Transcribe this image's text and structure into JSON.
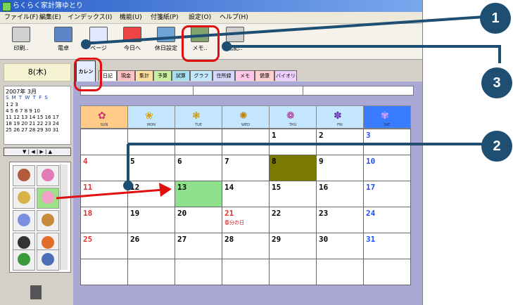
{
  "window": {
    "title": "らくらく家計簿ゆとり"
  },
  "menu": [
    "ファイル(F)",
    "編集(E)",
    "インデックス(I)",
    "機能(U)",
    "付箋紙(P)",
    "設定(O)",
    "ヘルプ(H)"
  ],
  "toolbar": [
    "印刷..",
    "電卓",
    "ページ",
    "今日へ",
    "休日設定",
    "メモ..",
    "転記.."
  ],
  "left": {
    "date": "8(木)",
    "mini_year_month": "2007年  3月",
    "mini_days": "S M T W T F S",
    "mini_rows": [
      "              1  2  3",
      "4  5  6  7  8  9 10",
      "11 12 13 14 15 16 17",
      "18 19 20 21 22 23 24",
      "25 26 27 28 29 30 31"
    ],
    "nav": "▼ | ◀ | ▶ | ▲"
  },
  "tabs": [
    "カレンダ",
    "日記",
    "現金",
    "集計",
    "予算",
    "試算",
    "グラフ",
    "住所録",
    "メモ",
    "健康",
    "バイオリズム"
  ],
  "calendar": {
    "weekday_labels": [
      "SUN",
      "MON",
      "TUE",
      "WED",
      "THU",
      "FRI",
      "SAT"
    ],
    "rows": [
      [
        "",
        "",
        "",
        "",
        "1",
        "2",
        "3"
      ],
      [
        "4",
        "5",
        "6",
        "7",
        "8",
        "9",
        "10"
      ],
      [
        "11",
        "12",
        "13",
        "14",
        "15",
        "16",
        "17"
      ],
      [
        "18",
        "19",
        "20",
        "21",
        "22",
        "23",
        "24"
      ],
      [
        "25",
        "26",
        "27",
        "28",
        "29",
        "30",
        "31"
      ],
      [
        "",
        "",
        "",
        "",
        "",
        "",
        ""
      ]
    ],
    "holiday": "春分の日"
  },
  "callouts": [
    "1",
    "2",
    "3"
  ],
  "colors": {
    "sun": "#e23030",
    "sat": "#1a4fff",
    "today": "#7a7a00",
    "selected": "#8ee08a",
    "callout": "#1e4f73",
    "highlight": "#e01010"
  }
}
